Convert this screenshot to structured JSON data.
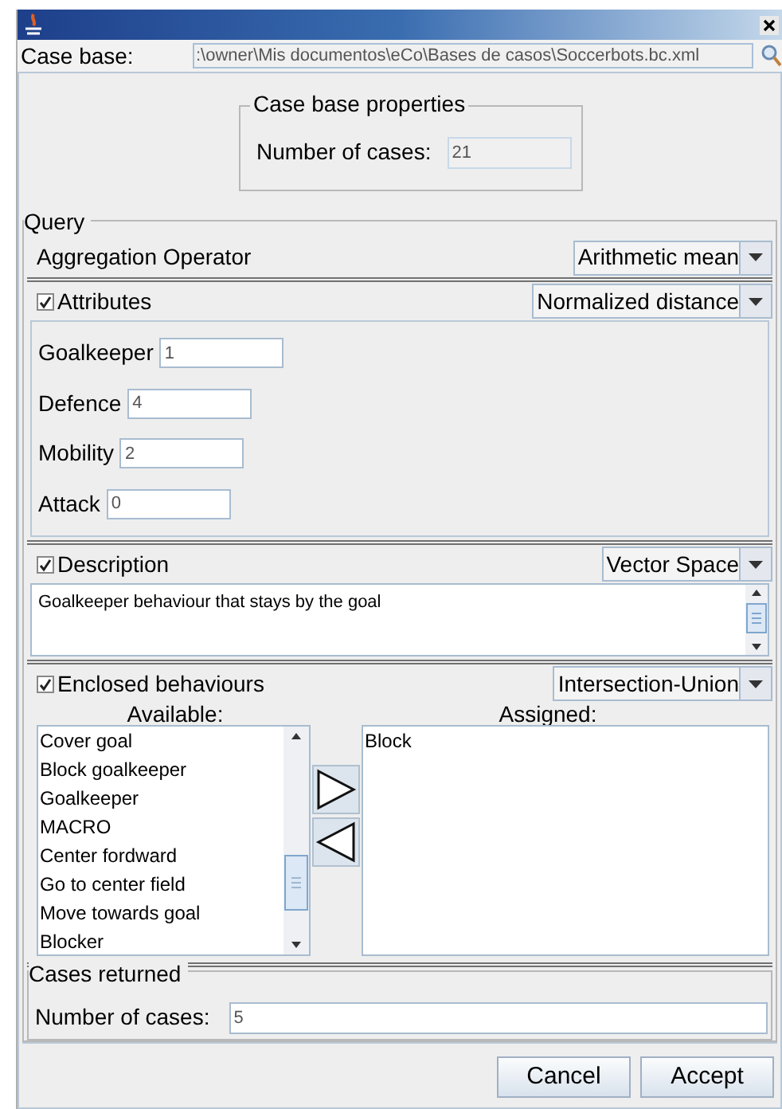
{
  "case_base": {
    "label": "Case base:",
    "value": ":\\owner\\Mis documentos\\eCo\\Bases de casos\\Soccerbots.bc.xml"
  },
  "case_base_properties": {
    "title": "Case base properties",
    "label": "Number of cases:",
    "value": "21"
  },
  "query": {
    "title": "Query",
    "aggregation": {
      "label": "Aggregation Operator",
      "value": "Arithmetic mean"
    },
    "sections": [
      {
        "kind": "attributes",
        "label": "Attributes",
        "checked": true,
        "method": "Normalized distance",
        "fields": [
          {
            "label": "Goalkeeper",
            "value": "1"
          },
          {
            "label": "Defence",
            "value": "4"
          },
          {
            "label": "Mobility",
            "value": "2"
          },
          {
            "label": "Attack",
            "value": "0"
          }
        ]
      },
      {
        "kind": "description",
        "label": "Description",
        "checked": true,
        "method": "Vector Space",
        "value": "Goalkeeper behaviour that stays by the goal"
      },
      {
        "kind": "behaviours",
        "label": "Enclosed behaviours",
        "checked": true,
        "method": "Intersection-Union",
        "available_label": "Available:",
        "available": [
          "Cover goal",
          "Block goalkeeper",
          "Goalkeeper",
          "MACRO",
          "Center fordward",
          "Go to center field",
          "Move towards goal",
          "Blocker"
        ],
        "assigned_label": "Assigned:",
        "assigned": [
          "Block"
        ]
      }
    ]
  },
  "cases_returned": {
    "title": "Cases returned",
    "label": "Number of cases:",
    "value": "5"
  },
  "buttons": [
    "Cancel",
    "Accept"
  ]
}
